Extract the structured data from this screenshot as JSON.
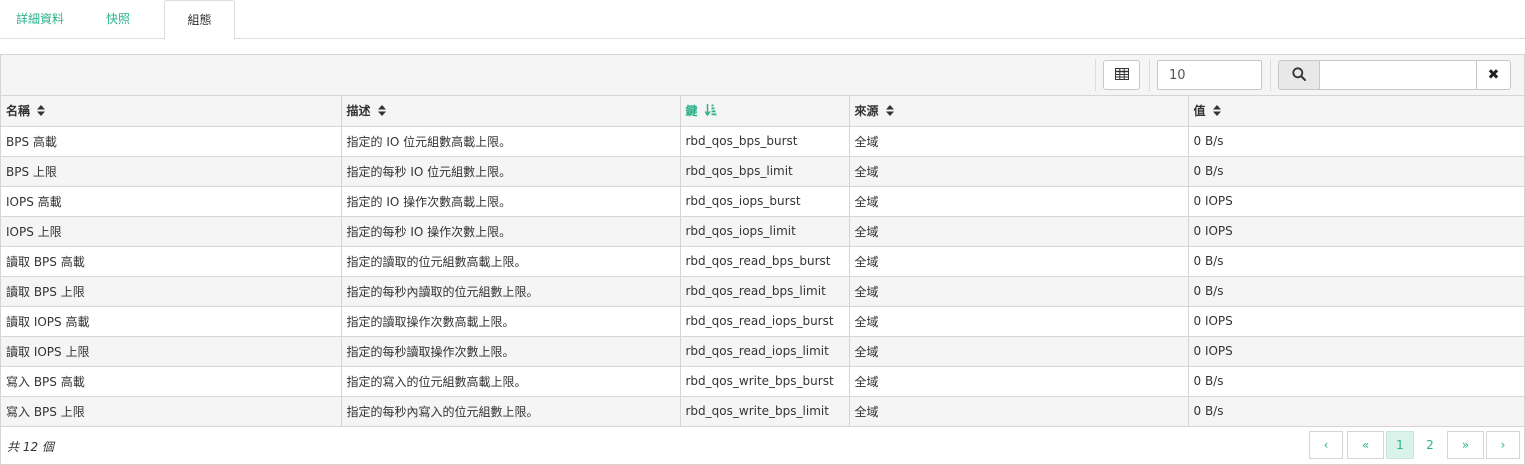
{
  "tabs": [
    {
      "label": "詳細資料"
    },
    {
      "label": "快照"
    },
    {
      "label": "組態"
    }
  ],
  "toolbar": {
    "page_size": "10",
    "search_placeholder": ""
  },
  "table": {
    "columns": [
      {
        "label": "名稱",
        "sorted": false
      },
      {
        "label": "描述",
        "sorted": false
      },
      {
        "label": "鍵",
        "sorted": true
      },
      {
        "label": "來源",
        "sorted": false
      },
      {
        "label": "值",
        "sorted": false
      }
    ],
    "rows": [
      [
        "BPS 高載",
        "指定的 IO 位元組數高載上限。",
        "rbd_qos_bps_burst",
        "全域",
        "0 B/s"
      ],
      [
        "BPS 上限",
        "指定的每秒 IO 位元組數上限。",
        "rbd_qos_bps_limit",
        "全域",
        "0 B/s"
      ],
      [
        "IOPS 高載",
        "指定的 IO 操作次數高載上限。",
        "rbd_qos_iops_burst",
        "全域",
        "0 IOPS"
      ],
      [
        "IOPS 上限",
        "指定的每秒 IO 操作次數上限。",
        "rbd_qos_iops_limit",
        "全域",
        "0 IOPS"
      ],
      [
        "讀取 BPS 高載",
        "指定的讀取的位元組數高載上限。",
        "rbd_qos_read_bps_burst",
        "全域",
        "0 B/s"
      ],
      [
        "讀取 BPS 上限",
        "指定的每秒內讀取的位元組數上限。",
        "rbd_qos_read_bps_limit",
        "全域",
        "0 B/s"
      ],
      [
        "讀取 IOPS 高載",
        "指定的讀取操作次數高載上限。",
        "rbd_qos_read_iops_burst",
        "全域",
        "0 IOPS"
      ],
      [
        "讀取 IOPS 上限",
        "指定的每秒讀取操作次數上限。",
        "rbd_qos_read_iops_limit",
        "全域",
        "0 IOPS"
      ],
      [
        "寫入 BPS 高載",
        "指定的寫入的位元組數高載上限。",
        "rbd_qos_write_bps_burst",
        "全域",
        "0 B/s"
      ],
      [
        "寫入 BPS 上限",
        "指定的每秒內寫入的位元組數上限。",
        "rbd_qos_write_bps_limit",
        "全域",
        "0 B/s"
      ]
    ]
  },
  "footer": {
    "total": "共 12 個",
    "pagination": {
      "prev": "‹",
      "first": "«",
      "pages": [
        "1",
        "2"
      ],
      "current": "1",
      "last": "»",
      "next": "›"
    }
  },
  "colors": {
    "accent": "#2bb38a",
    "header_bg": "#f5f5f5",
    "border": "#d5d5d5"
  }
}
